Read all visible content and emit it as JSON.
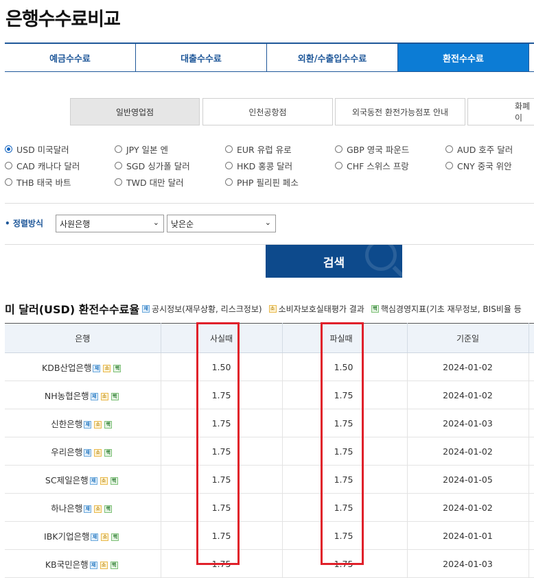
{
  "page_title": "은행수수료비교",
  "tabs": [
    {
      "label": "예금수수료",
      "active": false
    },
    {
      "label": "대출수수료",
      "active": false
    },
    {
      "label": "외환/수출입수수료",
      "active": false
    },
    {
      "label": "환전수수료",
      "active": true
    }
  ],
  "subtabs": [
    {
      "label": "일반영업점",
      "active": true
    },
    {
      "label": "인천공항점",
      "active": false
    },
    {
      "label": "외국동전 환전가능점포 안내",
      "active": false
    },
    {
      "label": "화폐이",
      "active": false
    }
  ],
  "currencies": [
    {
      "label": "USD 미국달러",
      "selected": true
    },
    {
      "label": "JPY 일본 엔",
      "selected": false
    },
    {
      "label": "EUR 유럽 유로",
      "selected": false
    },
    {
      "label": "GBP 영국 파운드",
      "selected": false
    },
    {
      "label": "AUD 호주 달러",
      "selected": false
    },
    {
      "label": "CAD 캐나다 달러",
      "selected": false
    },
    {
      "label": "SGD 싱가폴 달러",
      "selected": false
    },
    {
      "label": "HKD 홍콩 달러",
      "selected": false
    },
    {
      "label": "CHF 스위스 프랑",
      "selected": false
    },
    {
      "label": "CNY 중국 위안",
      "selected": false
    },
    {
      "label": "THB 태국 바트",
      "selected": false
    },
    {
      "label": "TWD 대만 달러",
      "selected": false
    },
    {
      "label": "PHP 필리핀 페소",
      "selected": false
    }
  ],
  "sort": {
    "label": "• 정렬방식",
    "select1": "사원은행",
    "select2": "낮은순"
  },
  "search_label": "검색",
  "section": {
    "title": "미 달러(USD) 환전수수료율",
    "legend": [
      {
        "badge": "재",
        "color": "blue",
        "text": "공시정보(재무상황, 리스크정보)"
      },
      {
        "badge": "소",
        "color": "orange",
        "text": "소비자보호실태평가 결과"
      },
      {
        "badge": "핵",
        "color": "green",
        "text": "핵심경영지표(기초 재무정보, BIS비율 등"
      }
    ]
  },
  "table": {
    "headers": [
      "은행",
      "사실때",
      "",
      "파실때",
      "기준일",
      ""
    ],
    "rows": [
      {
        "bank": "KDB산업은행",
        "buy": "1.50",
        "sell": "1.50",
        "date": "2024-01-02"
      },
      {
        "bank": "NH농협은행",
        "buy": "1.75",
        "sell": "1.75",
        "date": "2024-01-02"
      },
      {
        "bank": "신한은행",
        "buy": "1.75",
        "sell": "1.75",
        "date": "2024-01-03"
      },
      {
        "bank": "우리은행",
        "buy": "1.75",
        "sell": "1.75",
        "date": "2024-01-02"
      },
      {
        "bank": "SC제일은행",
        "buy": "1.75",
        "sell": "1.75",
        "date": "2024-01-05"
      },
      {
        "bank": "하나은행",
        "buy": "1.75",
        "sell": "1.75",
        "date": "2024-01-02"
      },
      {
        "bank": "IBK기업은행",
        "buy": "1.75",
        "sell": "1.75",
        "date": "2024-01-01"
      },
      {
        "bank": "KB국민은행",
        "buy": "1.75",
        "sell": "1.75",
        "date": "2024-01-03"
      }
    ],
    "row_badges": [
      "재",
      "소",
      "핵"
    ]
  },
  "colors": {
    "primary": "#1e5799",
    "tab_active": "#0c7cd5",
    "search_button": "#0d4a8c",
    "highlight_box": "#e0202a"
  }
}
